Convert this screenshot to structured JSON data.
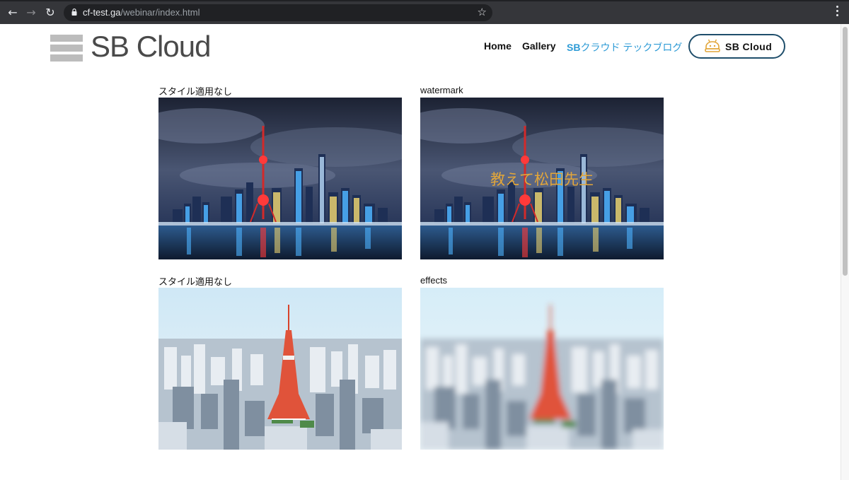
{
  "browser": {
    "url_host": "cf-test.ga",
    "url_path": "/webinar/index.html",
    "icons": {
      "back": "back-arrow-icon",
      "forward": "forward-arrow-icon",
      "reload": "reload-icon",
      "secure": "lock-icon",
      "bookmark": "star-icon",
      "menu": "more-vert-icon"
    }
  },
  "site": {
    "logo_text": "SB Cloud",
    "nav": {
      "home": "Home",
      "gallery": "Gallery",
      "blog_prefix": "SB",
      "blog_rest": "クラウド テックブログ"
    },
    "cta_label": "SB Cloud",
    "colors": {
      "nav_text": "#111111",
      "blog_link": "#2e9bd6",
      "cta_border": "#1f4e6b",
      "watermark": "#e2a63a",
      "logo_gray": "#bcbcbc"
    }
  },
  "gallery": {
    "items": [
      {
        "caption": "スタイル適用なし",
        "image": "shanghai-night-skyline"
      },
      {
        "caption": "watermark",
        "image": "shanghai-night-skyline",
        "overlay_text": "教えて松田先生"
      },
      {
        "caption": "スタイル適用なし",
        "image": "tokyo-tower-cityscape"
      },
      {
        "caption": "effects",
        "image": "tokyo-tower-cityscape-blurred"
      }
    ]
  }
}
